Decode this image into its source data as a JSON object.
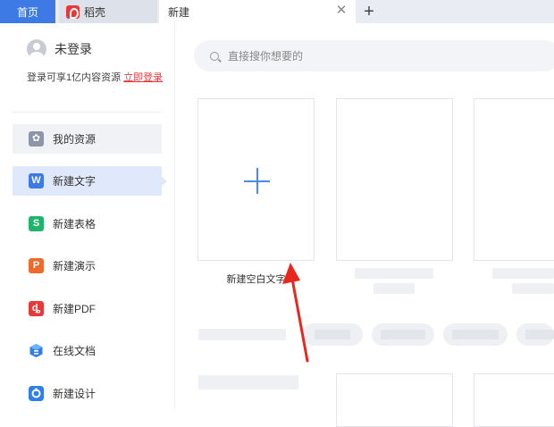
{
  "tabs": {
    "home": "首页",
    "daoke": "稻壳",
    "new": "新建"
  },
  "sidebar": {
    "user_name": "未登录",
    "login_tip": "登录可享1亿内容资源",
    "login_link": "立即登录",
    "items": [
      {
        "label": "我的资源",
        "icon": "star-icon"
      },
      {
        "label": "新建文字",
        "icon": "writer-icon"
      },
      {
        "label": "新建表格",
        "icon": "spreadsheet-icon"
      },
      {
        "label": "新建演示",
        "icon": "presentation-icon"
      },
      {
        "label": "新建PDF",
        "icon": "pdf-icon"
      },
      {
        "label": "在线文档",
        "icon": "online-doc-icon"
      },
      {
        "label": "新建设计",
        "icon": "design-icon"
      }
    ]
  },
  "search": {
    "placeholder": "直接搜你想要的"
  },
  "main": {
    "new_blank_label": "新建空白文字"
  },
  "colors": {
    "accent": "#3d7ae6",
    "arrow": "#e8281e"
  }
}
